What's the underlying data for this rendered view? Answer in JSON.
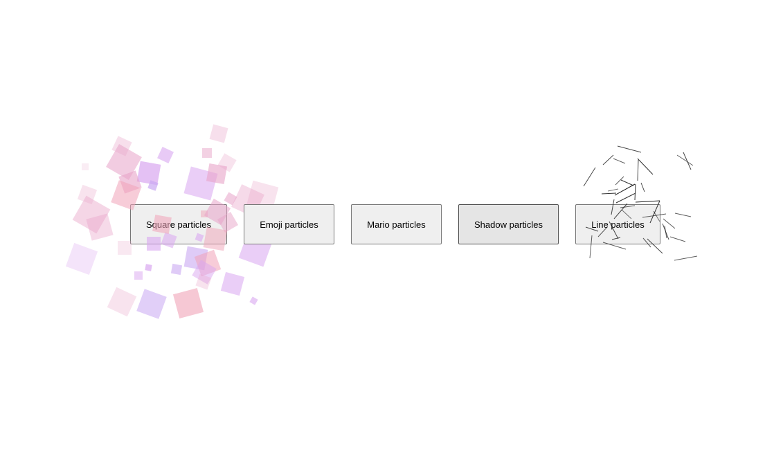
{
  "buttons": {
    "square": "Square particles",
    "emoji": "Emoji particles",
    "mario": "Mario particles",
    "shadow": "Shadow particles",
    "line": "Line particles"
  },
  "colors": {
    "button_bg": "#efefef",
    "button_bg_active": "#e5e5e5",
    "button_border": "#767676",
    "square_palette": [
      "#e8a3c8",
      "#d9a6f0",
      "#f0a3b8",
      "#c9a8f2",
      "#e6b3e6"
    ],
    "line_color": "#1a1a1a"
  }
}
